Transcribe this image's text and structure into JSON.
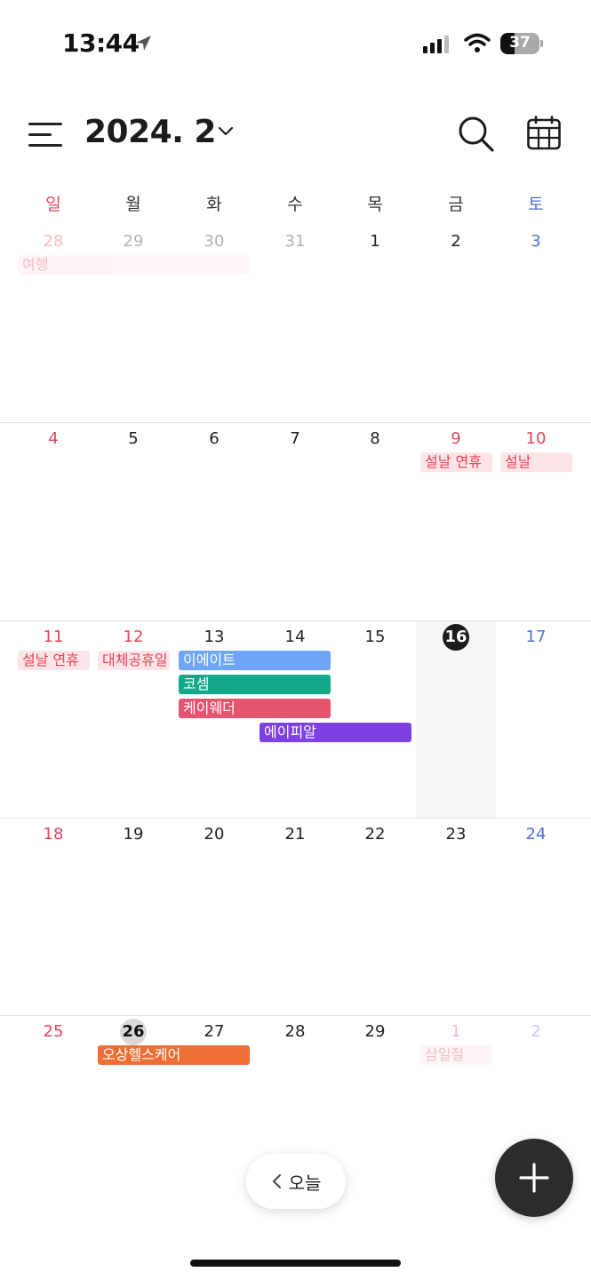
{
  "status_bar": {
    "time": "13:44",
    "battery": "37",
    "battery_level": 0.37
  },
  "header": {
    "title": "2024. 2"
  },
  "weekdays": [
    "일",
    "월",
    "화",
    "수",
    "목",
    "금",
    "토"
  ],
  "weeks": [
    {
      "days": [
        {
          "n": "28",
          "type": "sun",
          "other": true
        },
        {
          "n": "29",
          "other": true
        },
        {
          "n": "30",
          "other": true
        },
        {
          "n": "31",
          "other": true
        },
        {
          "n": "1"
        },
        {
          "n": "2"
        },
        {
          "n": "3",
          "type": "sat"
        }
      ],
      "events": [
        {
          "label": "여행",
          "start": 0,
          "span": 3,
          "style": "holiday",
          "faded": true
        }
      ]
    },
    {
      "days": [
        {
          "n": "4",
          "type": "sun"
        },
        {
          "n": "5"
        },
        {
          "n": "6"
        },
        {
          "n": "7"
        },
        {
          "n": "8"
        },
        {
          "n": "9",
          "type": "sun"
        },
        {
          "n": "10",
          "type": "sun"
        }
      ],
      "events": [
        {
          "label": "설날 연휴",
          "start": 5,
          "span": 1,
          "style": "holiday"
        },
        {
          "label": "설날",
          "start": 6,
          "span": 1,
          "style": "holiday"
        }
      ]
    },
    {
      "days": [
        {
          "n": "11",
          "type": "sun"
        },
        {
          "n": "12",
          "type": "sun"
        },
        {
          "n": "13"
        },
        {
          "n": "14"
        },
        {
          "n": "15"
        },
        {
          "n": "16",
          "today": true
        },
        {
          "n": "17",
          "type": "sat"
        }
      ],
      "events": [
        {
          "label": "설날 연휴",
          "start": 0,
          "span": 1,
          "style": "holiday",
          "row": 0
        },
        {
          "label": "대체공휴일",
          "start": 1,
          "span": 1,
          "style": "holiday",
          "row": 0
        },
        {
          "label": "이에이트",
          "start": 2,
          "span": 2,
          "style": "solid",
          "color": "#6fa5f5",
          "row": 0
        },
        {
          "label": "코셈",
          "start": 2,
          "span": 2,
          "style": "solid",
          "color": "#14a88a",
          "row": 1
        },
        {
          "label": "케이웨더",
          "start": 2,
          "span": 2,
          "style": "solid",
          "color": "#e4556f",
          "row": 2
        },
        {
          "label": "에이피알",
          "start": 3,
          "span": 2,
          "style": "solid",
          "color": "#7f40e3",
          "row": 3
        }
      ]
    },
    {
      "days": [
        {
          "n": "18",
          "type": "sun"
        },
        {
          "n": "19"
        },
        {
          "n": "20"
        },
        {
          "n": "21"
        },
        {
          "n": "22"
        },
        {
          "n": "23"
        },
        {
          "n": "24",
          "type": "sat"
        }
      ],
      "events": []
    },
    {
      "days": [
        {
          "n": "25",
          "type": "sun"
        },
        {
          "n": "26",
          "selected": true
        },
        {
          "n": "27"
        },
        {
          "n": "28"
        },
        {
          "n": "29"
        },
        {
          "n": "1",
          "type": "sun",
          "other": true
        },
        {
          "n": "2",
          "type": "sat",
          "other": true
        }
      ],
      "events": [
        {
          "label": "오상헬스케어",
          "start": 1,
          "span": 2,
          "style": "solid",
          "color": "#ee6e35",
          "row": 0
        },
        {
          "label": "삼일절",
          "start": 5,
          "span": 1,
          "style": "holiday",
          "faded": true,
          "row": 0
        }
      ]
    }
  ],
  "today_button": {
    "label": "오늘"
  },
  "icons": {
    "menu": "menu-icon",
    "chevron": "chevron-down-icon",
    "search": "search-icon",
    "calendar_view": "calendar-view-icon",
    "back": "chevron-left-icon",
    "add": "plus-icon",
    "location": "location-arrow-icon",
    "signal": "signal-icon",
    "wifi": "wifi-icon",
    "battery": "battery-icon"
  }
}
